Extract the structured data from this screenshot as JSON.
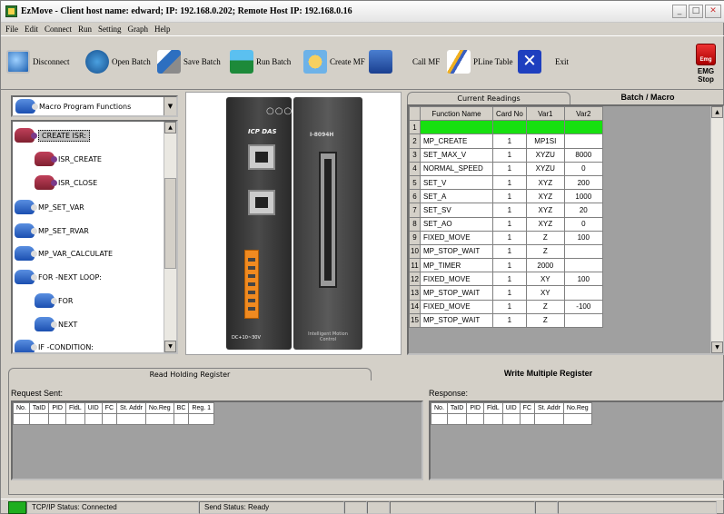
{
  "window": {
    "title": "EzMove - Client host name: edward;  IP: 192.168.0.202;       Remote Host IP: 192.168.0.16",
    "minimize": "_",
    "maximize": "□",
    "close": "✕"
  },
  "menu": [
    "File",
    "Edit",
    "Connect",
    "Run",
    "Setting",
    "Graph",
    "Help"
  ],
  "toolbar": {
    "disconnect": "Disconnect",
    "open_batch": "Open Batch",
    "save_batch": "Save Batch",
    "run_batch": "Run Batch",
    "create_mf": "Create MF",
    "call_mf": "Call MF",
    "pline_table": "PLine Table",
    "exit": "Exit",
    "emg_stop": "EMG Stop",
    "emg_icon_text": "Emg"
  },
  "tree": {
    "category": "Macro Program Functions",
    "items": [
      {
        "label": "CREATE ISR:",
        "color": "red",
        "selected": true
      },
      {
        "label": "ISR_CREATE",
        "color": "red"
      },
      {
        "label": "ISR_CLOSE",
        "color": "red"
      },
      {
        "label": "MP_SET_VAR",
        "color": "blue"
      },
      {
        "label": "MP_SET_RVAR",
        "color": "blue"
      },
      {
        "label": "MP_VAR_CALCULATE",
        "color": "blue"
      },
      {
        "label": "FOR -NEXT LOOP:",
        "color": "blue"
      },
      {
        "label": "FOR",
        "color": "blue"
      },
      {
        "label": "NEXT",
        "color": "blue"
      },
      {
        "label": "IF -CONDITION:",
        "color": "blue"
      }
    ]
  },
  "device": {
    "brand": "ICP DAS",
    "model": "I-8094H",
    "caption": "Intelligent Motion Control",
    "power": "DC+10~30V"
  },
  "right_tabs": {
    "current_readings": "Current Readings",
    "batch_macro": "Batch / Macro"
  },
  "batch_table": {
    "headers": [
      "Function Name",
      "Card No",
      "Var1",
      "Var2"
    ],
    "rows": [
      [
        "",
        "",
        "",
        ""
      ],
      [
        "MP_CREATE",
        "1",
        "MP1SI",
        ""
      ],
      [
        "SET_MAX_V",
        "1",
        "XYZU",
        "8000"
      ],
      [
        "NORMAL_SPEED",
        "1",
        "XYZU",
        "0"
      ],
      [
        "SET_V",
        "1",
        "XYZ",
        "200"
      ],
      [
        "SET_A",
        "1",
        "XYZ",
        "1000"
      ],
      [
        "SET_SV",
        "1",
        "XYZ",
        "20"
      ],
      [
        "SET_AO",
        "1",
        "XYZ",
        "0"
      ],
      [
        "FIXED_MOVE",
        "1",
        "Z",
        "100"
      ],
      [
        "MP_STOP_WAIT",
        "1",
        "Z",
        ""
      ],
      [
        "MP_TIMER",
        "1",
        "2000",
        ""
      ],
      [
        "FIXED_MOVE",
        "1",
        "XY",
        "100"
      ],
      [
        "MP_STOP_WAIT",
        "1",
        "XY",
        ""
      ],
      [
        "FIXED_MOVE",
        "1",
        "Z",
        "-100"
      ],
      [
        "MP_STOP_WAIT",
        "1",
        "Z",
        ""
      ]
    ]
  },
  "bottom_tabs": {
    "read_holding": "Read Holding Register",
    "write_multiple": "Write Multiple Register"
  },
  "request": {
    "label": "Request Sent:",
    "headers": [
      "No.",
      "TaID",
      "PID",
      "FldL",
      "UID",
      "FC",
      "St. Addr",
      "No.Reg",
      "BC",
      "Reg. 1"
    ]
  },
  "response": {
    "label": "Response:",
    "headers": [
      "No.",
      "TaID",
      "PID",
      "FldL",
      "UID",
      "FC",
      "St. Addr",
      "No.Reg"
    ]
  },
  "status": {
    "tcp": "TCP/IP Status: Connected",
    "send": "Send Status: Ready"
  }
}
